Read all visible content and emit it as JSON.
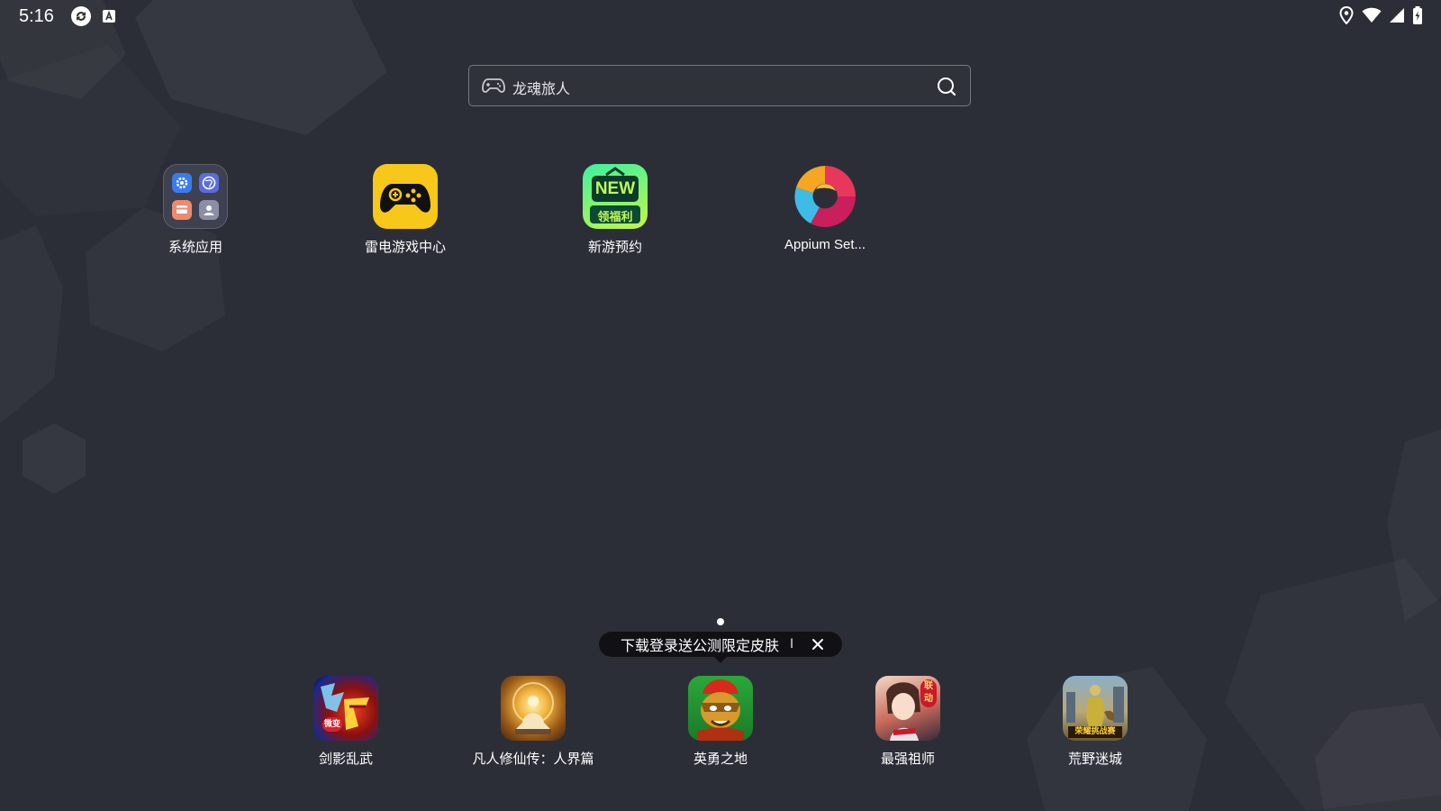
{
  "status_bar": {
    "time": "5:16",
    "left_icons": [
      "sync-icon",
      "a-keyboard-icon"
    ],
    "right_icons": [
      "location-icon",
      "wifi-icon",
      "signal-icon",
      "battery-icon"
    ]
  },
  "search": {
    "value": "龙魂旅人",
    "left_icon": "gamepad-icon",
    "right_icon": "search-icon"
  },
  "apps": [
    {
      "label": "系统应用",
      "icon": "folder-icon"
    },
    {
      "label": "雷电游戏中心",
      "icon": "gamepad-icon"
    },
    {
      "label": "新游预约",
      "icon": "new-icon",
      "badge_top": "NEW",
      "badge_bottom": "领福利"
    },
    {
      "label": "Appium Set...",
      "icon": "appium-icon"
    }
  ],
  "tooltip": {
    "text": "下载登录送公测限定皮肤",
    "separator": "I",
    "close_icon": "close-icon"
  },
  "dock": [
    {
      "label": "剑影乱武",
      "icon": "game-icon-1",
      "badge": "微变"
    },
    {
      "label": "凡人修仙传：人界篇",
      "icon": "game-icon-2"
    },
    {
      "label": "英勇之地",
      "icon": "game-icon-3"
    },
    {
      "label": "最强祖师",
      "icon": "game-icon-4",
      "badge": "联动"
    },
    {
      "label": "荒野迷城",
      "icon": "game-icon-5",
      "badge": "荣耀挑战赛"
    }
  ],
  "colors": {
    "background": "#2c2e37",
    "accent_yellow": "#f5c518",
    "tooltip_bg": "#111115"
  }
}
